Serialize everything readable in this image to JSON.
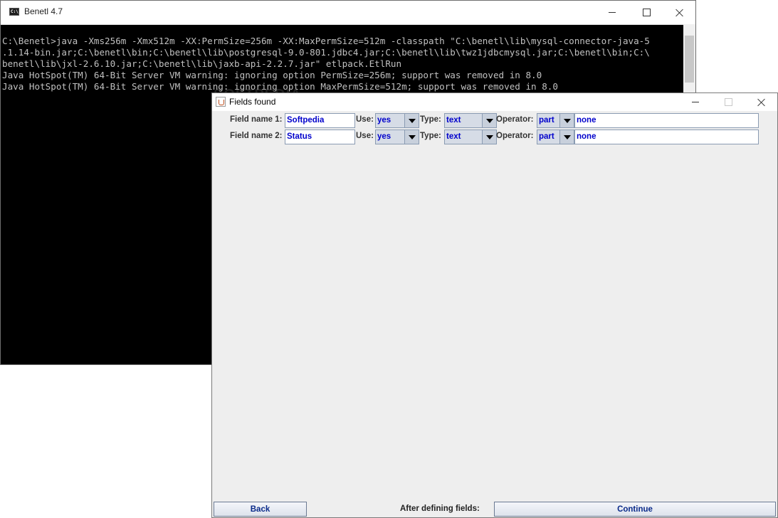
{
  "console": {
    "title": "Benetl 4.7",
    "lines": [
      "C:\\Benetl>java -Xms256m -Xmx512m -XX:PermSize=256m -XX:MaxPermSize=512m -classpath \"C:\\benetl\\lib\\mysql-connector-java-5",
      ".1.14-bin.jar;C:\\benetl\\bin;C:\\benetl\\lib\\postgresql-9.0-801.jdbc4.jar;C:\\benetl\\lib\\twz1jdbcmysql.jar;C:\\benetl\\bin;C:\\",
      "benetl\\lib\\jxl-2.6.10.jar;C:\\benetl\\lib\\jaxb-api-2.2.7.jar\" etlpack.EtlRun",
      "Java HotSpot(TM) 64-Bit Server VM warning: ignoring option PermSize=256m; support was removed in 8.0",
      "Java HotSpot(TM) 64-Bit Server VM warning: ignoring option MaxPermSize=512m; support was removed in 8.0"
    ]
  },
  "dialog": {
    "title": "Fields found",
    "labels": {
      "use": "Use:",
      "type": "Type:",
      "operator": "Operator:"
    },
    "rows": [
      {
        "field_label": "Field name 1:",
        "field_value": "Softpedia",
        "use": "yes",
        "type": "text",
        "operator": "part",
        "value": "none"
      },
      {
        "field_label": "Field name 2:",
        "field_value": "Status",
        "use": "yes",
        "type": "text",
        "operator": "part",
        "value": "none"
      }
    ],
    "footer": {
      "back_label": "Back",
      "hint": "After defining fields:",
      "continue_label": "Continue"
    }
  },
  "watermark": "SOFTPEDIA"
}
